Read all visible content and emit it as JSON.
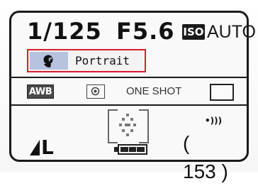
{
  "exposure": {
    "shutter_speed": "1/125",
    "aperture": "F5.6",
    "iso_label": "ISO",
    "iso_value": "AUTO"
  },
  "picture_style": {
    "icon": "portrait-style-icon",
    "label": "Portrait"
  },
  "settings_row": {
    "white_balance": "AWB",
    "metering_icon": "evaluative-metering-icon",
    "af_mode": "ONE SHOT",
    "drive_icon": "single-shot-drive-icon"
  },
  "status": {
    "image_quality": "L",
    "quality_icon": "large-fine-quality-icon",
    "af_point_icon": "af-point-selection-icon",
    "battery_icon": "battery-full-icon",
    "beep_icon": "beep-icon",
    "shots_remaining": "153"
  },
  "colors": {
    "highlight_border": "#d81e2c",
    "style_chip": "#b7c2df",
    "display_bg": "#f9f9f9",
    "ink": "#1a1a1a"
  }
}
